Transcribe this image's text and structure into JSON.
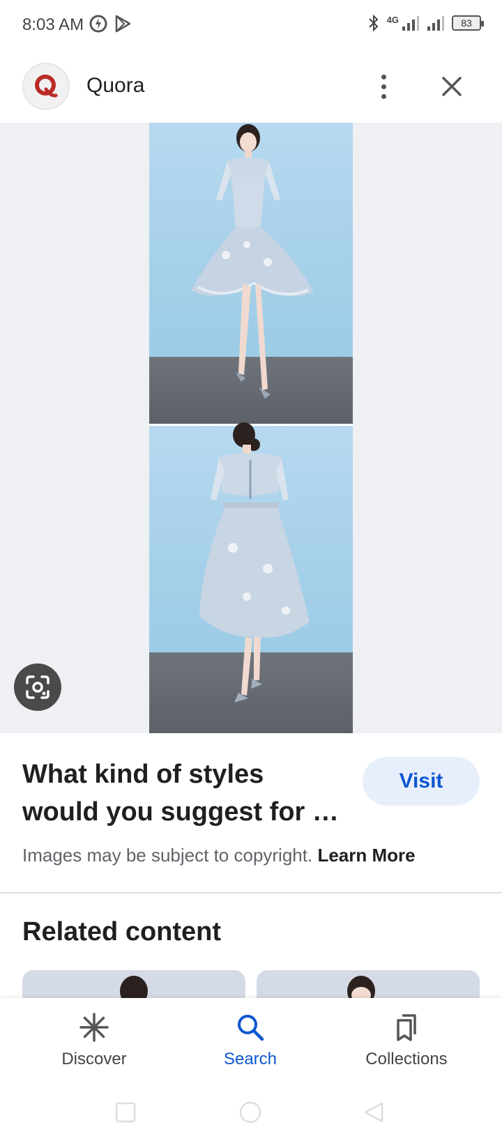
{
  "status_bar": {
    "time": "8:03 AM",
    "network": "4G",
    "battery": "83"
  },
  "header": {
    "site_name": "Quora",
    "logo_letter": "Q"
  },
  "result": {
    "title": "What kind of styles would you suggest for …",
    "visit_label": "Visit",
    "copyright_text": "Images may be subject to copyright.",
    "learn_more_label": "Learn More"
  },
  "related": {
    "title": "Related content"
  },
  "bottom_nav": {
    "items": [
      {
        "label": "Discover",
        "icon": "asterisk-icon",
        "active": false
      },
      {
        "label": "Search",
        "icon": "search-icon",
        "active": true
      },
      {
        "label": "Collections",
        "icon": "bookmarks-icon",
        "active": false
      }
    ]
  },
  "colors": {
    "accent": "#0b57d0",
    "visit_bg": "#e8effc",
    "quora_red": "#b92b27",
    "image_bg": "#eef0f3",
    "wall_blue": "#a9d2ec",
    "floor_gray": "#6b7078"
  }
}
